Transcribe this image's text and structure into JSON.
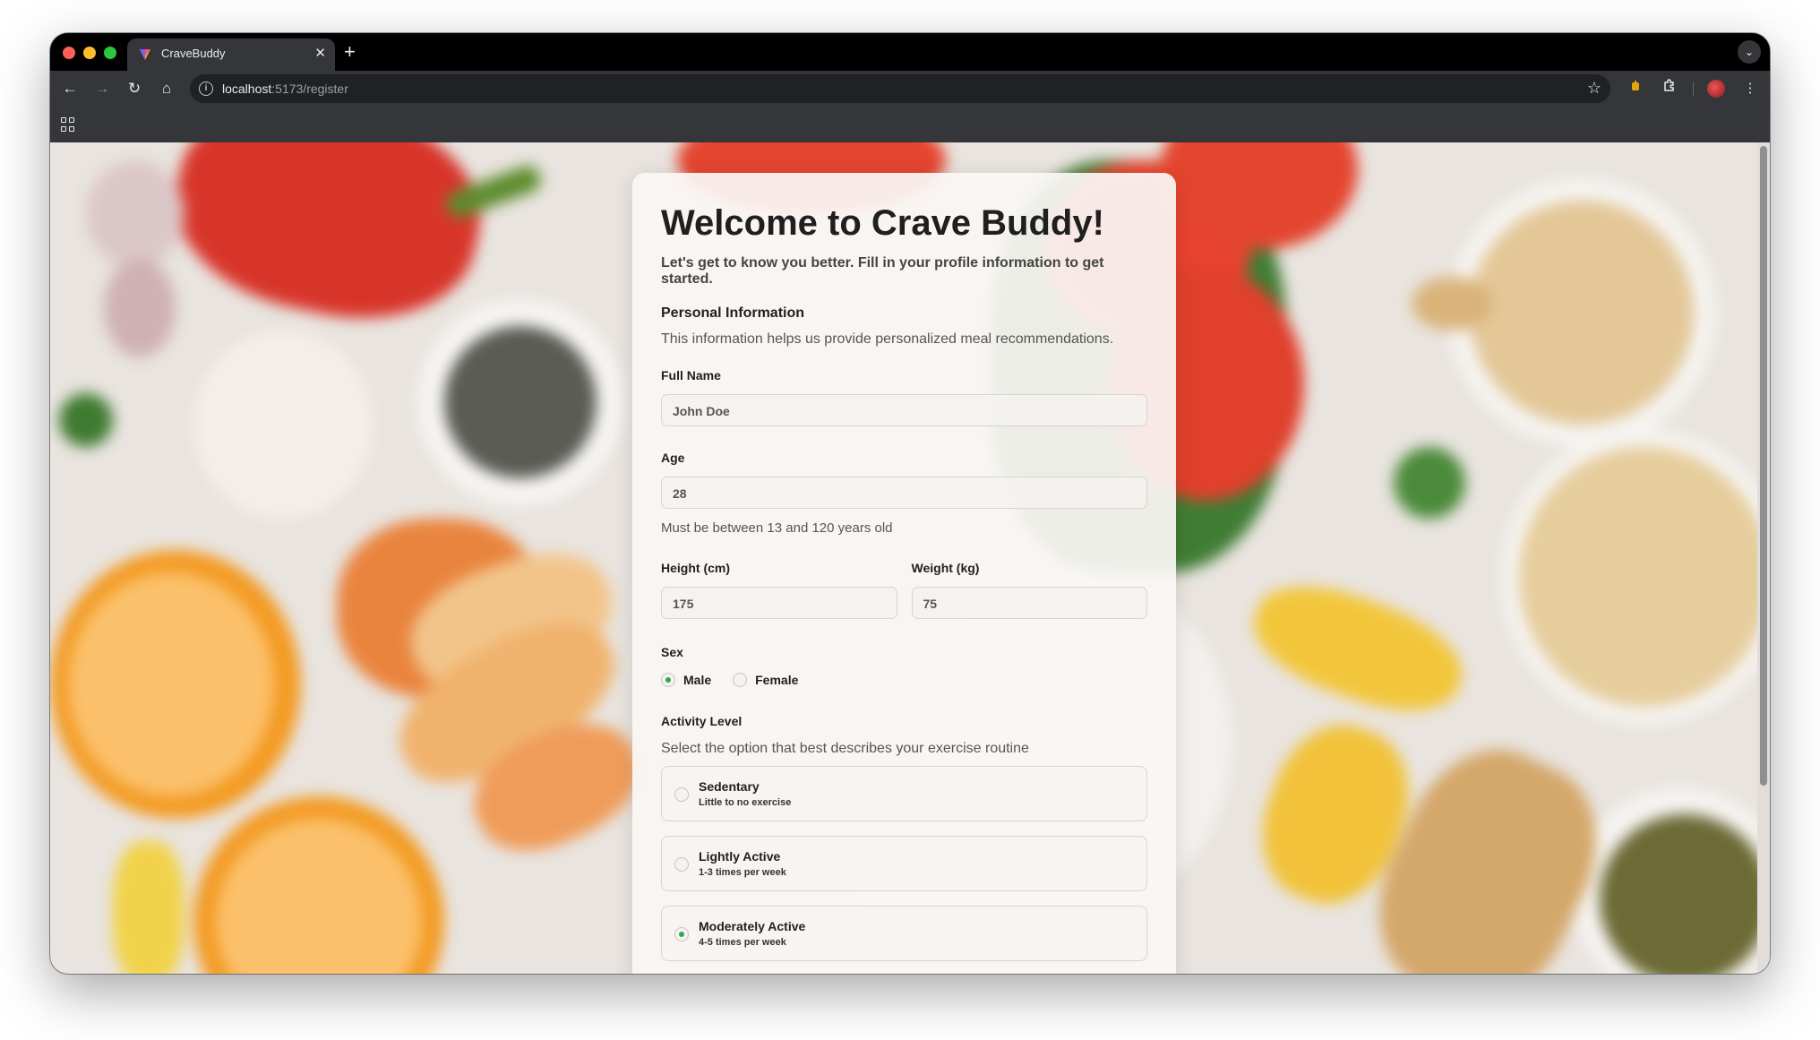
{
  "browser": {
    "tab_title": "CraveBuddy",
    "url_host": "localhost",
    "url_path": ":5173/register"
  },
  "form": {
    "title": "Welcome to Crave Buddy!",
    "subtitle": "Let's get to know you better. Fill in your profile information to get started.",
    "section_title": "Personal Information",
    "section_desc": "This information helps us provide personalized meal recommendations.",
    "full_name": {
      "label": "Full Name",
      "placeholder": "John Doe"
    },
    "age": {
      "label": "Age",
      "placeholder": "28",
      "helper": "Must be between 13 and 120 years old"
    },
    "height": {
      "label": "Height (cm)",
      "placeholder": "175"
    },
    "weight": {
      "label": "Weight (kg)",
      "placeholder": "75"
    },
    "sex": {
      "label": "Sex",
      "options": [
        {
          "label": "Male",
          "selected": true
        },
        {
          "label": "Female",
          "selected": false
        }
      ]
    },
    "activity": {
      "label": "Activity Level",
      "desc": "Select the option that best describes your exercise routine",
      "options": [
        {
          "name": "Sedentary",
          "desc": "Little to no exercise",
          "selected": false
        },
        {
          "name": "Lightly Active",
          "desc": "1-3 times per week",
          "selected": false
        },
        {
          "name": "Moderately Active",
          "desc": "4-5 times per week",
          "selected": true
        }
      ]
    }
  },
  "colors": {
    "accent_green": "#2fa84f",
    "tab_bg": "#35363a",
    "chrome_bg": "#000000"
  }
}
